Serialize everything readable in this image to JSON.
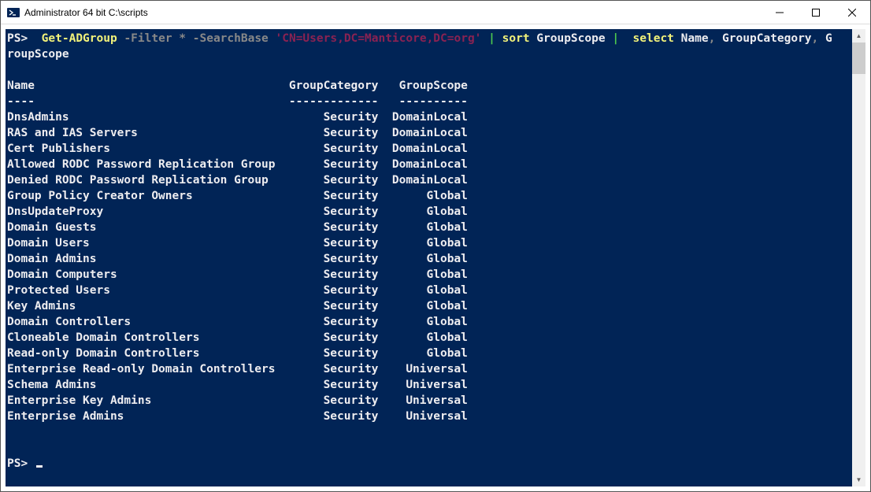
{
  "window": {
    "title": "Administrator 64 bit C:\\scripts"
  },
  "command": {
    "prompt": "PS>",
    "cmdlet": "Get-ADGroup",
    "p_filter": "-Filter",
    "star": "*",
    "p_searchbase": "-SearchBase",
    "searchbase_val": "'CN=Users,DC=Manticore,DC=org'",
    "pipe1": "|",
    "sort": "sort",
    "sort_arg": "GroupScope",
    "pipe2": "|",
    "select": "select",
    "sel_name": "Name",
    "comma1": ",",
    "sel_cat": "GroupCategory",
    "comma2": ",",
    "sel_scope_head": "G",
    "wrap_tail": "roupScope"
  },
  "table": {
    "headers": {
      "name": "Name",
      "cat": "GroupCategory",
      "scope": "GroupScope"
    },
    "sep": {
      "name": "----",
      "cat": "-------------",
      "scope": "----------"
    },
    "rows": [
      {
        "name": "DnsAdmins",
        "cat": "Security",
        "scope": "DomainLocal"
      },
      {
        "name": "RAS and IAS Servers",
        "cat": "Security",
        "scope": "DomainLocal"
      },
      {
        "name": "Cert Publishers",
        "cat": "Security",
        "scope": "DomainLocal"
      },
      {
        "name": "Allowed RODC Password Replication Group",
        "cat": "Security",
        "scope": "DomainLocal"
      },
      {
        "name": "Denied RODC Password Replication Group",
        "cat": "Security",
        "scope": "DomainLocal"
      },
      {
        "name": "Group Policy Creator Owners",
        "cat": "Security",
        "scope": "Global"
      },
      {
        "name": "DnsUpdateProxy",
        "cat": "Security",
        "scope": "Global"
      },
      {
        "name": "Domain Guests",
        "cat": "Security",
        "scope": "Global"
      },
      {
        "name": "Domain Users",
        "cat": "Security",
        "scope": "Global"
      },
      {
        "name": "Domain Admins",
        "cat": "Security",
        "scope": "Global"
      },
      {
        "name": "Domain Computers",
        "cat": "Security",
        "scope": "Global"
      },
      {
        "name": "Protected Users",
        "cat": "Security",
        "scope": "Global"
      },
      {
        "name": "Key Admins",
        "cat": "Security",
        "scope": "Global"
      },
      {
        "name": "Domain Controllers",
        "cat": "Security",
        "scope": "Global"
      },
      {
        "name": "Cloneable Domain Controllers",
        "cat": "Security",
        "scope": "Global"
      },
      {
        "name": "Read-only Domain Controllers",
        "cat": "Security",
        "scope": "Global"
      },
      {
        "name": "Enterprise Read-only Domain Controllers",
        "cat": "Security",
        "scope": "Universal"
      },
      {
        "name": "Schema Admins",
        "cat": "Security",
        "scope": "Universal"
      },
      {
        "name": "Enterprise Key Admins",
        "cat": "Security",
        "scope": "Universal"
      },
      {
        "name": "Enterprise Admins",
        "cat": "Security",
        "scope": "Universal"
      }
    ]
  },
  "prompt2": "PS>"
}
